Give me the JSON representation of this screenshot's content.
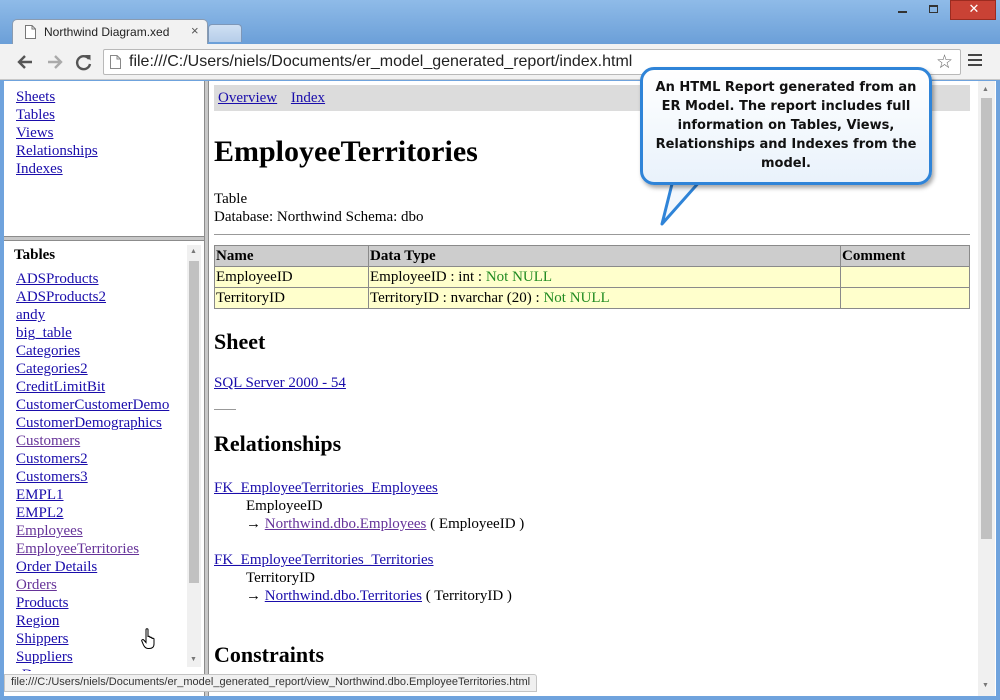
{
  "browser": {
    "tab_title": "Northwind Diagram.xed",
    "tab_close": "×",
    "url": "file:///C:/Users/niels/Documents/er_model_generated_report/index.html",
    "status_url": "file:///C:/Users/niels/Documents/er_model_generated_report/view_Northwind.dbo.EmployeeTerritories.html",
    "close_glyph": "✕"
  },
  "nav_frame": {
    "items": [
      "Sheets",
      "Tables",
      "Views",
      "Relationships",
      "Indexes"
    ]
  },
  "tables_frame": {
    "heading": "Tables",
    "items": [
      "ADSProducts",
      "ADSProducts2",
      "andy",
      "big_table",
      "Categories",
      "Categories2",
      "CreditLimitBit",
      "CustomerCustomerDemo",
      "CustomerDemographics",
      "Customers",
      "Customers2",
      "Customers3",
      "EMPL1",
      "EMPL2",
      "Employees",
      "EmployeeTerritories",
      "Order Details",
      "Orders",
      "Products",
      "Region",
      "Shippers",
      "Suppliers",
      "sDemo"
    ]
  },
  "main": {
    "nav": [
      "Overview",
      "Index"
    ],
    "title": "EmployeeTerritories",
    "object_type": "Table",
    "database_line": "Database: Northwind Schema: dbo",
    "columns_header": [
      "Name",
      "Data Type",
      "Comment"
    ],
    "columns": [
      {
        "name": "EmployeeID",
        "type": "EmployeeID : int : ",
        "null": "Not NULL",
        "comment": ""
      },
      {
        "name": "TerritoryID",
        "type": "TerritoryID : nvarchar (20) : ",
        "null": "Not NULL",
        "comment": ""
      }
    ],
    "sheet_heading": "Sheet",
    "sheet_link": "SQL Server 2000 - 54",
    "relationships_heading": "Relationships",
    "relationships": [
      {
        "name": "FK_EmployeeTerritories_Employees",
        "column": "EmployeeID",
        "arrow": "→ ",
        "target": "Northwind.dbo.Employees",
        "target_col": " ( EmployeeID )"
      },
      {
        "name": "FK_EmployeeTerritories_Territories",
        "column": "TerritoryID",
        "arrow": "→ ",
        "target": "Northwind.dbo.Territories",
        "target_col": " ( TerritoryID )"
      }
    ],
    "constraints_heading": "Constraints"
  },
  "callout": {
    "text": "An HTML Report generated from an ER Model. The report includes full information on Tables, Views, Relationships and Indexes from the model."
  },
  "colors": {
    "link": "#1a0dab",
    "visited": "#663399",
    "not_null": "#228b22",
    "row_bg": "#ffffcc",
    "callout_border": "#2f84d8",
    "close_button": "#c94235"
  },
  "icons": [
    "page-icon",
    "back-arrow-icon",
    "forward-arrow-icon",
    "reload-icon",
    "star-icon",
    "menu-icon",
    "hand-cursor-icon"
  ]
}
